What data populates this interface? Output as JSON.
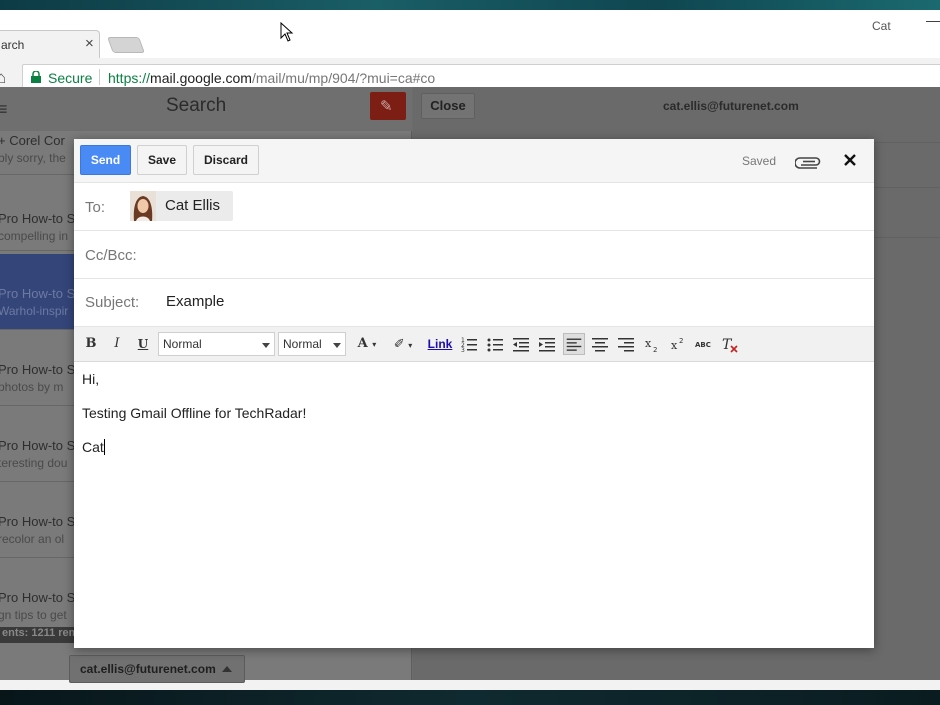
{
  "browser": {
    "tab_title": "arch",
    "tab_close": "×",
    "profile": "Cat",
    "minimize": "—",
    "secure_label": "Secure",
    "url_scheme": "https://",
    "url_host": "mail.google.com",
    "url_path": "/mail/mu/mp/904/?mui=ca#co"
  },
  "gmail": {
    "search_title": "Search",
    "mail_list": [
      {
        "sender": "+ Corel Cor",
        "snippet": "bly sorry, the"
      },
      {
        "sender": "Pro How-to Se",
        "snippet": "compelling in"
      },
      {
        "sender": "Pro How-to Se",
        "snippet": "Warhol-inspir"
      },
      {
        "sender": "Pro How-to Se",
        "snippet": "photos by m"
      },
      {
        "sender": "Pro How-to Se",
        "snippet": "teresting dou"
      },
      {
        "sender": "Pro How-to Se",
        "snippet": "recolor an ol"
      },
      {
        "sender": "Pro How-to Se",
        "snippet": "gn tips to get"
      }
    ],
    "status_text": "ents: 1211 rem",
    "account": "cat.ellis@futurenet.com",
    "close_label": "Close",
    "right_account": "cat.ellis@futurenet.com"
  },
  "compose": {
    "send_label": "Send",
    "save_label": "Save",
    "discard_label": "Discard",
    "saved_status": "Saved",
    "to_label": "To:",
    "to_recipient": "Cat Ellis",
    "cc_label": "Cc/Bcc:",
    "subject_label": "Subject:",
    "subject_value": "Example",
    "toolbar": {
      "bold": "B",
      "italic": "I",
      "underline": "U",
      "font_family": "Normal",
      "font_size": "Normal",
      "link": "Link"
    },
    "body_lines": [
      "Hi,",
      "Testing Gmail Offline for TechRadar!",
      "Cat"
    ]
  }
}
